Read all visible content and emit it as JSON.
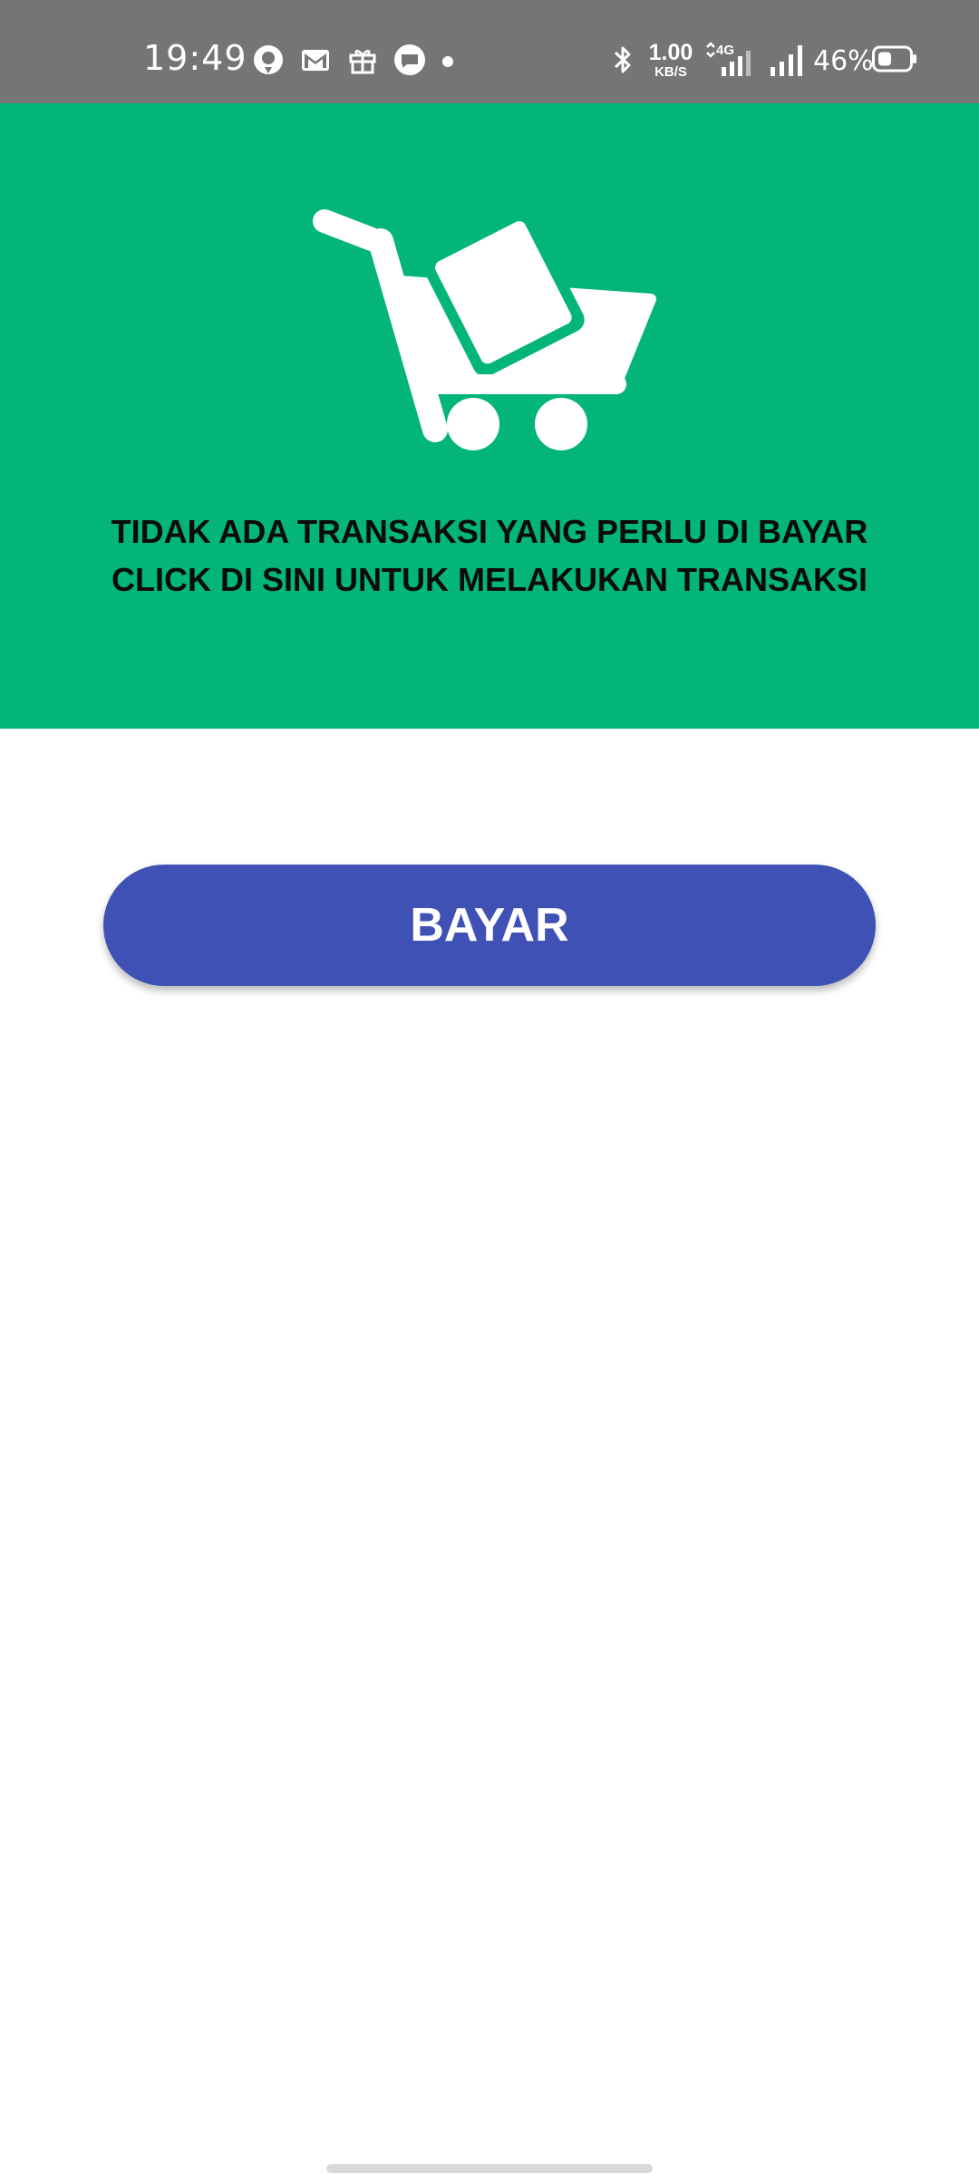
{
  "status_bar": {
    "time": "19:49",
    "network_speed_value": "1.00",
    "network_speed_unit": "KB/S",
    "network_type": "4G",
    "battery_percent": "46%",
    "icons": [
      "maps-icon",
      "gmail-icon",
      "gift-icon",
      "chat-icon",
      "notification-dot",
      "bluetooth-icon",
      "signal-4g-icon",
      "signal-icon",
      "battery-icon"
    ]
  },
  "hero": {
    "illustration": "cart-icon",
    "background_color": "#03b677",
    "message_line1": "TIDAK ADA TRANSAKSI YANG PERLU DI BAYAR",
    "message_line2": "CLICK DI SINI UNTUK MELAKUKAN TRANSAKSI"
  },
  "actions": {
    "pay_label": "BAYAR",
    "pay_color": "#3f51b5"
  }
}
